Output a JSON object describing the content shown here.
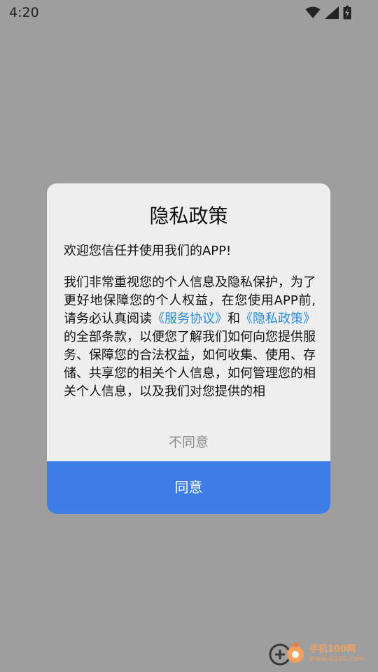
{
  "status_bar": {
    "time": "4:20",
    "icons": [
      "wifi-icon",
      "cellular-signal-icon",
      "battery-charging-icon"
    ]
  },
  "dialog": {
    "title": "隐私政策",
    "greeting": "欢迎您信任并使用我们的APP!",
    "body_intro": " 我们非常重视您的个人信息及隐私保护，为了更好地保障您的个人权益，在您使用APP前,请务必认真阅读",
    "link_service": "《服务协议》",
    "joiner": "和",
    "link_privacy": "《隐私政策》",
    "body_rest": "的全部条款，以便您了解我们如何向您提供服务、保障您的合法权益，如何收集、使用、存储、共享您的相关个人信息，如何管理您的相关个人信息，以及我们对您提供的相",
    "disagree_label": "不同意",
    "agree_label": "同意"
  },
  "watermark": {
    "brand": "手机100网",
    "url": "www.sj100.com"
  },
  "colors": {
    "overlay": "#9e9e9e",
    "dialog_bg": "#eeeeee",
    "link": "#2b8bd8",
    "agree_bg": "#3c7de6",
    "disagree_text": "#8c8c8c"
  }
}
